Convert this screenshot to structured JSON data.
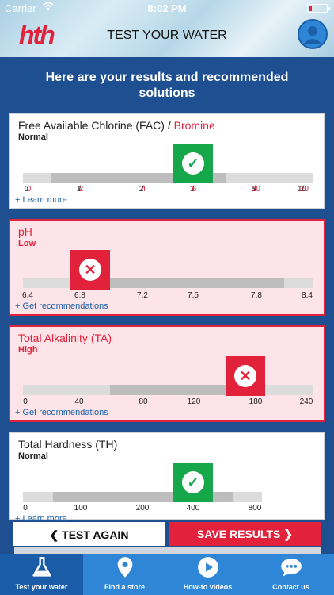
{
  "status_bar": {
    "carrier": "Carrier",
    "time": "8:02 PM"
  },
  "header": {
    "logo": "hth",
    "title": "TEST YOUR WATER"
  },
  "results_title": "Here are your results and recommended solutions",
  "cards": [
    {
      "name": "Free Available Chlorine (FAC) / ",
      "name_alt": "Bromine",
      "status": "Normal",
      "result": "ok",
      "ticks": [
        [
          "0",
          "0"
        ],
        [
          "1",
          "2"
        ],
        [
          "2",
          "4"
        ],
        [
          "3",
          "6"
        ],
        [
          "5",
          "10"
        ],
        [
          "10",
          "20"
        ]
      ],
      "link": "+ Learn more"
    },
    {
      "name": "pH",
      "status": "Low",
      "result": "bad",
      "ticks": [
        "6.4",
        "6.8",
        "7.2",
        "7.5",
        "7.8",
        "8.4"
      ],
      "link": "+ Get recommendations"
    },
    {
      "name": "Total Alkalinity (TA)",
      "status": "High",
      "result": "bad",
      "ticks": [
        "0",
        "40",
        "80",
        "120",
        "180",
        "240"
      ],
      "link": "+ Get recommendations"
    },
    {
      "name": "Total Hardness (TH)",
      "status": "Normal",
      "result": "ok",
      "ticks": [
        "0",
        "100",
        "200",
        "400",
        "800"
      ],
      "link": "+ Learn more"
    }
  ],
  "buttons": {
    "test_again": "TEST AGAIN",
    "save_results": "SAVE RESULTS"
  },
  "tabs": [
    {
      "label": "Test your water",
      "icon": "flask-icon"
    },
    {
      "label": "Find a store",
      "icon": "location-pin-icon"
    },
    {
      "label": "How-to videos",
      "icon": "play-icon"
    },
    {
      "label": "Contact us",
      "icon": "chat-bubble-icon"
    }
  ],
  "colors": {
    "brand_red": "#e2213a",
    "ok_green": "#16a74a",
    "navy": "#1d4f91",
    "tab_blue": "#2f86d6"
  }
}
